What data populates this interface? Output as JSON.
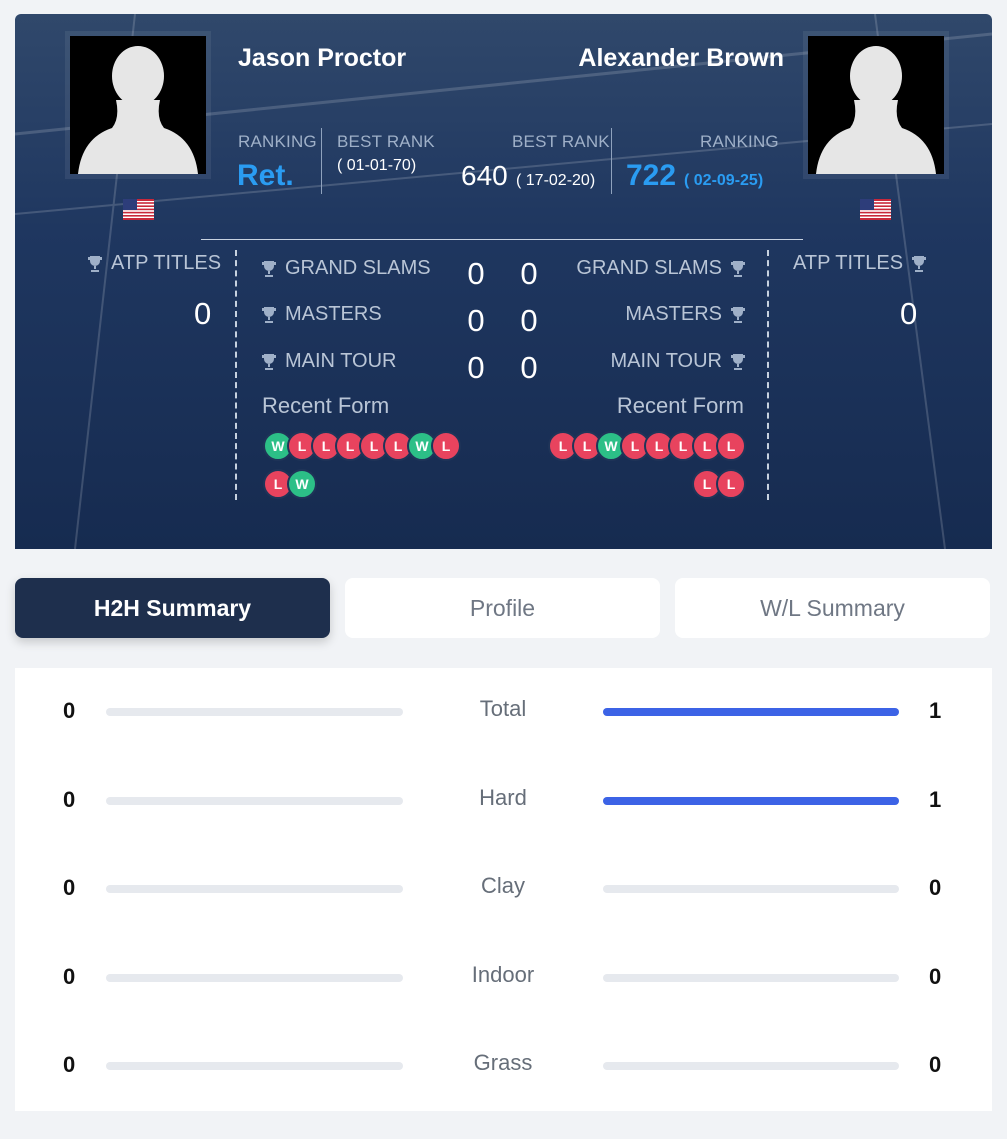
{
  "player_left": {
    "name": "Jason Proctor",
    "ranking_label": "RANKING",
    "ranking_value": "Ret.",
    "best_rank_label": "BEST RANK",
    "best_rank_date": "( 01-01-70)",
    "atp_titles_label": "ATP TITLES",
    "atp_titles": "0",
    "flag": "us-flag-icon",
    "recent_form": [
      "W",
      "L",
      "L",
      "L",
      "L",
      "L",
      "W",
      "L",
      "L",
      "W"
    ]
  },
  "player_right": {
    "name": "Alexander Brown",
    "best_rank_label": "BEST RANK",
    "best_rank_value": "640",
    "best_rank_date": "( 17-02-20)",
    "ranking_label": "RANKING",
    "ranking_value": "722",
    "ranking_date": "( 02-09-25)",
    "atp_titles_label": "ATP TITLES",
    "atp_titles": "0",
    "flag": "us-flag-icon",
    "recent_form": [
      "L",
      "L",
      "W",
      "L",
      "L",
      "L",
      "L",
      "L",
      "L",
      "L"
    ]
  },
  "titles": [
    {
      "label": "GRAND SLAMS",
      "left": "0",
      "right": "0"
    },
    {
      "label": "MASTERS",
      "left": "0",
      "right": "0"
    },
    {
      "label": "MAIN TOUR",
      "left": "0",
      "right": "0"
    }
  ],
  "recent_form_label": "Recent Form",
  "tabs": [
    "H2H Summary",
    "Profile",
    "W/L Summary"
  ],
  "active_tab": 0,
  "h2h": [
    {
      "category": "Total",
      "left": "0",
      "right": "1",
      "left_frac": 0,
      "right_frac": 1
    },
    {
      "category": "Hard",
      "left": "0",
      "right": "1",
      "left_frac": 0,
      "right_frac": 1
    },
    {
      "category": "Clay",
      "left": "0",
      "right": "0",
      "left_frac": 0,
      "right_frac": 0
    },
    {
      "category": "Indoor",
      "left": "0",
      "right": "0",
      "left_frac": 0,
      "right_frac": 0
    },
    {
      "category": "Grass",
      "left": "0",
      "right": "0",
      "left_frac": 0,
      "right_frac": 0
    }
  ],
  "colors": {
    "accent_blue": "#2a9cf2",
    "bar_fill": "#3c63e6",
    "loss": "#e8435e",
    "win": "#2cbf87",
    "tab_active": "#1e2f4d"
  }
}
